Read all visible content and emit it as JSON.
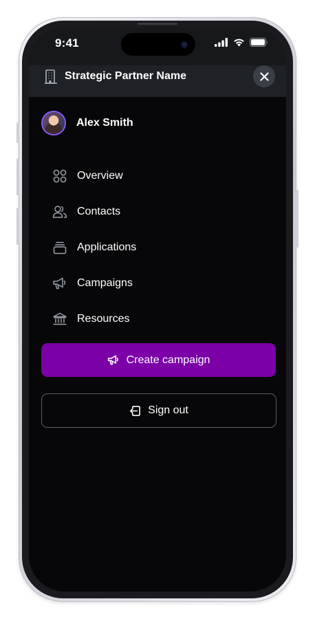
{
  "status_bar": {
    "time": "9:41"
  },
  "header": {
    "partner_name": "Strategic Partner Name"
  },
  "user": {
    "name": "Alex Smith"
  },
  "nav": {
    "items": [
      {
        "label": "Overview",
        "icon": "grid-icon"
      },
      {
        "label": "Contacts",
        "icon": "users-icon"
      },
      {
        "label": "Applications",
        "icon": "stack-icon"
      },
      {
        "label": "Campaigns",
        "icon": "megaphone-icon"
      },
      {
        "label": "Resources",
        "icon": "bank-icon"
      }
    ]
  },
  "actions": {
    "create_label": "Create campaign",
    "signout_label": "Sign out"
  },
  "colors": {
    "accent": "#7b00a8",
    "background": "#070709",
    "header_bg": "#1e2126"
  }
}
